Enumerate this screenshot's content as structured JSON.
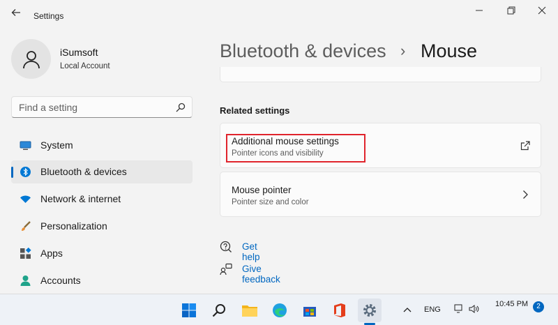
{
  "window": {
    "title": "Settings"
  },
  "user": {
    "name": "iSumsoft",
    "account_type": "Local Account"
  },
  "search": {
    "placeholder": "Find a setting"
  },
  "sidebar": {
    "items": [
      {
        "label": "System",
        "icon": "monitor-icon",
        "active": false
      },
      {
        "label": "Bluetooth & devices",
        "icon": "bluetooth-icon",
        "active": true
      },
      {
        "label": "Network & internet",
        "icon": "wifi-icon",
        "active": false
      },
      {
        "label": "Personalization",
        "icon": "paintbrush-icon",
        "active": false
      },
      {
        "label": "Apps",
        "icon": "apps-grid-icon",
        "active": false
      },
      {
        "label": "Accounts",
        "icon": "person-icon",
        "active": false
      }
    ]
  },
  "breadcrumb": {
    "parent": "Bluetooth & devices",
    "separator": "›",
    "current": "Mouse"
  },
  "related": {
    "title": "Related settings",
    "cards": [
      {
        "title": "Additional mouse settings",
        "subtitle": "Pointer icons and visibility",
        "icon": "external-link-icon",
        "highlighted": true
      },
      {
        "title": "Mouse pointer",
        "subtitle": "Pointer size and color",
        "icon": "chevron-right-icon",
        "highlighted": false
      }
    ]
  },
  "help_links": [
    {
      "label": "Get help",
      "icon": "help-chat-icon"
    },
    {
      "label": "Give feedback",
      "icon": "feedback-icon"
    }
  ],
  "taskbar": {
    "language": "ENG",
    "time": "10:45 PM",
    "date": "",
    "notification_count": "2",
    "apps": [
      "start-icon",
      "search-icon",
      "file-explorer-icon",
      "edge-icon",
      "store-icon",
      "office-icon",
      "settings-icon"
    ]
  },
  "colors": {
    "accent": "#0067c0",
    "highlight_box": "#e0242c",
    "background": "#f3f3f3"
  }
}
